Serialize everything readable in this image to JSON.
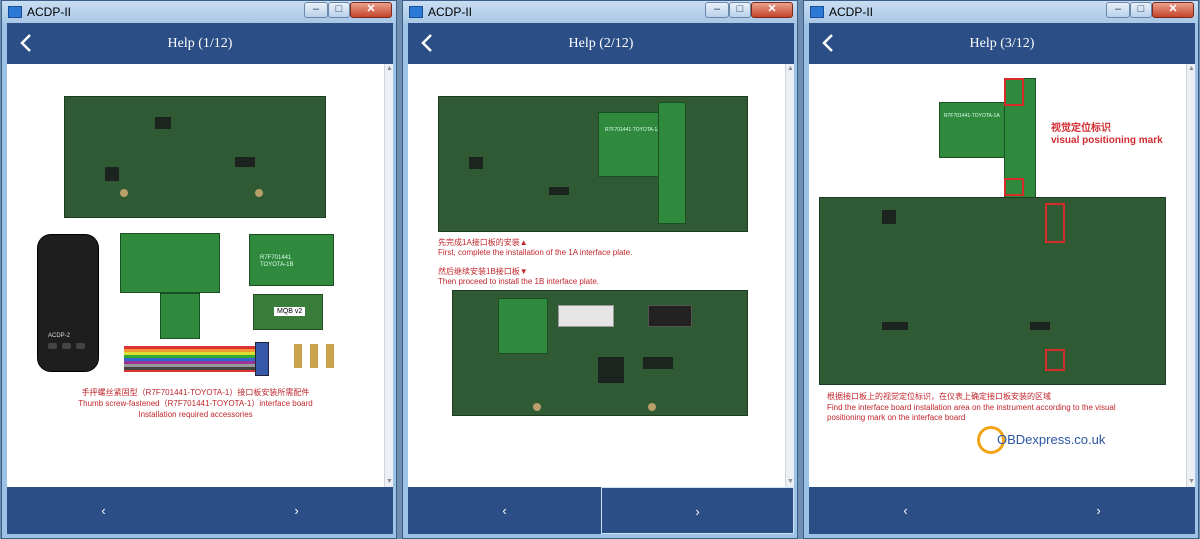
{
  "app_title": "ACDP-II",
  "window_controls": {
    "minimize": "–",
    "maximize": "□",
    "close": "✕"
  },
  "nav": {
    "prev_label": "‹",
    "next_label": "›"
  },
  "pages": [
    {
      "title": "Help (1/12)",
      "captions": [
        "手抨螺丝紧固型（R7F701441-TOYOTA-1）接口板安装所需配件",
        "Thumb screw-fastened（R7F701441-TOYOTA-1）interface board",
        "Installation required accessories"
      ],
      "labels": {
        "device_brand": "ACDP-2",
        "board_text": "R7F701441 TOYOTA-1B",
        "mqb_label": "MQB v2"
      }
    },
    {
      "title": "Help (2/12)",
      "captions": [
        "先完成1A接口板的安装▲",
        "First, complete the installation of the 1A interface plate.",
        "然后继续安装1B接口板▼",
        "Then proceed to install the 1B interface plate."
      ],
      "labels": {
        "board_text": "R7F701441-TOYOTA-1A"
      }
    },
    {
      "title": "Help (3/12)",
      "captions": [
        "根据接口板上的视觉定位标识，在仪表上确定接口板安装的区域",
        "Find the interface board installation area on the instrument according to the visual",
        "positioning mark on the interface board"
      ],
      "mark_label_cn": "视觉定位标识",
      "mark_label_en": "visual positioning mark",
      "watermark": "OBDexpress.co.uk",
      "labels": {
        "board_text": "R7F701441-TOYOTA-1A"
      }
    }
  ],
  "colors": {
    "header": "#2b4e86",
    "caption_red": "#c0262c",
    "pcb_green": "#2f5a34",
    "module_green": "#2f8a3e"
  }
}
